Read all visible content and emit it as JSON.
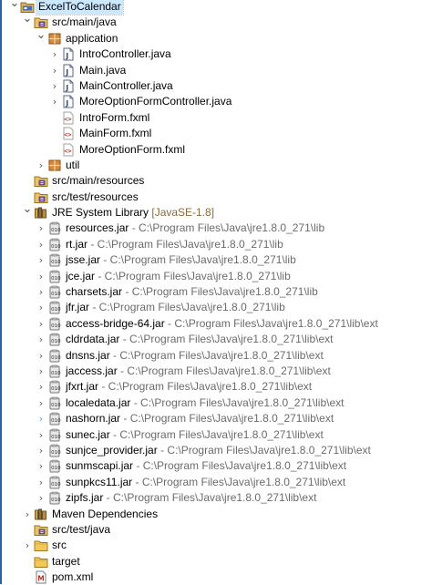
{
  "tree": [
    {
      "label": "ExcelToCalendar",
      "depth": 0,
      "chevron": "down",
      "icon": "project-icon",
      "selected": true
    },
    {
      "label": "src/main/java",
      "depth": 1,
      "chevron": "down",
      "icon": "source-folder-icon"
    },
    {
      "label": "application",
      "depth": 2,
      "chevron": "down",
      "icon": "package-icon"
    },
    {
      "label": "IntroController.java",
      "depth": 3,
      "chevron": "right",
      "icon": "java-file-icon"
    },
    {
      "label": "Main.java",
      "depth": 3,
      "chevron": "right",
      "icon": "java-file-icon"
    },
    {
      "label": "MainController.java",
      "depth": 3,
      "chevron": "right",
      "icon": "java-file-icon"
    },
    {
      "label": "MoreOptionFormController.java",
      "depth": 3,
      "chevron": "right",
      "icon": "java-file-icon"
    },
    {
      "label": "IntroForm.fxml",
      "depth": 3,
      "chevron": "none",
      "icon": "fxml-file-icon"
    },
    {
      "label": "MainForm.fxml",
      "depth": 3,
      "chevron": "none",
      "icon": "fxml-file-icon"
    },
    {
      "label": "MoreOptionForm.fxml",
      "depth": 3,
      "chevron": "none",
      "icon": "fxml-file-icon"
    },
    {
      "label": "util",
      "depth": 2,
      "chevron": "right",
      "icon": "package-icon"
    },
    {
      "label": "src/main/resources",
      "depth": 1,
      "chevron": "none",
      "icon": "source-folder-icon"
    },
    {
      "label": "src/test/resources",
      "depth": 1,
      "chevron": "none",
      "icon": "source-folder-icon"
    },
    {
      "label": "JRE System Library",
      "decor": " [JavaSE-1.8]",
      "depth": 1,
      "chevron": "down",
      "icon": "library-icon"
    },
    {
      "label": "resources.jar",
      "path": " - C:\\Program Files\\Java\\jre1.8.0_271\\lib",
      "depth": 2,
      "chevron": "right",
      "icon": "jar-icon"
    },
    {
      "label": "rt.jar",
      "path": " - C:\\Program Files\\Java\\jre1.8.0_271\\lib",
      "depth": 2,
      "chevron": "right",
      "icon": "jar-icon"
    },
    {
      "label": "jsse.jar",
      "path": " - C:\\Program Files\\Java\\jre1.8.0_271\\lib",
      "depth": 2,
      "chevron": "right",
      "icon": "jar-icon"
    },
    {
      "label": "jce.jar",
      "path": " - C:\\Program Files\\Java\\jre1.8.0_271\\lib",
      "depth": 2,
      "chevron": "right",
      "icon": "jar-icon"
    },
    {
      "label": "charsets.jar",
      "path": " - C:\\Program Files\\Java\\jre1.8.0_271\\lib",
      "depth": 2,
      "chevron": "right",
      "icon": "jar-icon"
    },
    {
      "label": "jfr.jar",
      "path": " - C:\\Program Files\\Java\\jre1.8.0_271\\lib",
      "depth": 2,
      "chevron": "right",
      "icon": "jar-icon"
    },
    {
      "label": "access-bridge-64.jar",
      "path": " - C:\\Program Files\\Java\\jre1.8.0_271\\lib\\ext",
      "depth": 2,
      "chevron": "right",
      "icon": "jar-icon"
    },
    {
      "label": "cldrdata.jar",
      "path": " - C:\\Program Files\\Java\\jre1.8.0_271\\lib\\ext",
      "depth": 2,
      "chevron": "right",
      "icon": "jar-icon"
    },
    {
      "label": "dnsns.jar",
      "path": " - C:\\Program Files\\Java\\jre1.8.0_271\\lib\\ext",
      "depth": 2,
      "chevron": "right",
      "icon": "jar-icon"
    },
    {
      "label": "jaccess.jar",
      "path": " - C:\\Program Files\\Java\\jre1.8.0_271\\lib\\ext",
      "depth": 2,
      "chevron": "right",
      "icon": "jar-icon"
    },
    {
      "label": "jfxrt.jar",
      "path": " - C:\\Program Files\\Java\\jre1.8.0_271\\lib\\ext",
      "depth": 2,
      "chevron": "right",
      "icon": "jar-icon"
    },
    {
      "label": "localedata.jar",
      "path": " - C:\\Program Files\\Java\\jre1.8.0_271\\lib\\ext",
      "depth": 2,
      "chevron": "right",
      "icon": "jar-icon"
    },
    {
      "label": "nashorn.jar",
      "path": " - C:\\Program Files\\Java\\jre1.8.0_271\\lib\\ext",
      "depth": 2,
      "chevron": "right",
      "icon": "jar-icon",
      "chevron_color": "#4aa3df"
    },
    {
      "label": "sunec.jar",
      "path": " - C:\\Program Files\\Java\\jre1.8.0_271\\lib\\ext",
      "depth": 2,
      "chevron": "right",
      "icon": "jar-icon"
    },
    {
      "label": "sunjce_provider.jar",
      "path": " - C:\\Program Files\\Java\\jre1.8.0_271\\lib\\ext",
      "depth": 2,
      "chevron": "right",
      "icon": "jar-icon"
    },
    {
      "label": "sunmscapi.jar",
      "path": " - C:\\Program Files\\Java\\jre1.8.0_271\\lib\\ext",
      "depth": 2,
      "chevron": "right",
      "icon": "jar-icon"
    },
    {
      "label": "sunpkcs11.jar",
      "path": " - C:\\Program Files\\Java\\jre1.8.0_271\\lib\\ext",
      "depth": 2,
      "chevron": "right",
      "icon": "jar-icon"
    },
    {
      "label": "zipfs.jar",
      "path": " - C:\\Program Files\\Java\\jre1.8.0_271\\lib\\ext",
      "depth": 2,
      "chevron": "right",
      "icon": "jar-icon"
    },
    {
      "label": "Maven Dependencies",
      "depth": 1,
      "chevron": "right",
      "icon": "library-icon"
    },
    {
      "label": "src/test/java",
      "depth": 1,
      "chevron": "none",
      "icon": "source-folder-icon"
    },
    {
      "label": "src",
      "depth": 1,
      "chevron": "right",
      "icon": "folder-icon"
    },
    {
      "label": "target",
      "depth": 1,
      "chevron": "none",
      "icon": "folder-icon"
    },
    {
      "label": "pom.xml",
      "depth": 1,
      "chevron": "none",
      "icon": "maven-file-icon"
    }
  ],
  "colors": {
    "selection": "#cce8ff",
    "path_text": "#6b6b6b",
    "decoration_text": "#8a6a3a",
    "chevron": "#555555",
    "accent_bar": "#2f5fa8"
  }
}
